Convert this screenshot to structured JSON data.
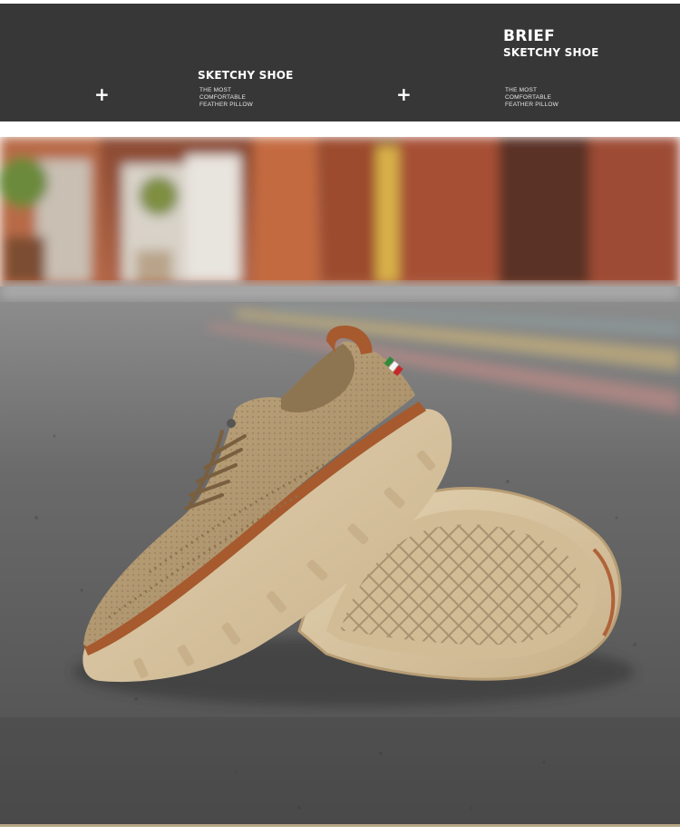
{
  "banner": {
    "left": {
      "title": "SKETCHY SHOE",
      "lines": [
        "THE MOST",
        "COMFORTABLE",
        "FEATHER PILLOW"
      ]
    },
    "right": {
      "heading": "BRIEF",
      "title": "SKETCHY SHOE",
      "lines": [
        "THE MOST",
        "COMFORTABLE",
        "FEATHER PILLOW"
      ]
    },
    "plus_icon": "plus-icon",
    "background_color": "#373737"
  },
  "photo": {
    "subject": "khaki knit shoe with sole facing up",
    "colors": {
      "upper": "#b29a73",
      "sole": "#d9c6a3",
      "welt": "#a65a2e",
      "asphalt": "#5d5d5d"
    }
  }
}
